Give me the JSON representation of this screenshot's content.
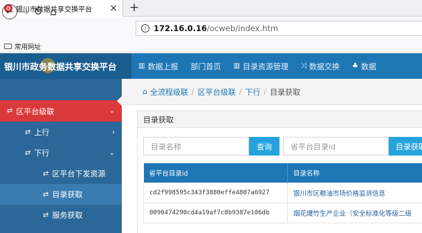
{
  "browser": {
    "tab_title": "银川市数据共享交换平台",
    "tab_close": "×",
    "new_tab": "+",
    "url_host": "172.16.0.16",
    "url_path": "/ocweb/index.htm",
    "bookmark_folder": "常用网址"
  },
  "header": {
    "brand": "银川市政务数据共享交换平台",
    "nav": [
      {
        "label": "数据上报",
        "icon": "bar-chart-icon"
      },
      {
        "label": "部门首页",
        "icon": ""
      },
      {
        "label": "目录资源管理",
        "icon": "bar-chart-icon"
      },
      {
        "label": "数据交换",
        "icon": "shuffle-icon"
      },
      {
        "label": "数据",
        "icon": "sitemap-icon"
      }
    ]
  },
  "sidebar": {
    "sync": "区平台级联",
    "up": "上行",
    "down": "下行",
    "issue": "区平台下发资源",
    "fetch": "目录获取",
    "service": "服务获取"
  },
  "breadcrumb": {
    "items": [
      "全流程级联",
      "区平台级联",
      "下行",
      "目录获取"
    ]
  },
  "panel": {
    "title": "目录获取",
    "name_placeholder": "目录名称",
    "query_label": "查询",
    "id_placeholder": "省平台目录id",
    "fetch_label": "目录获取"
  },
  "table": {
    "headers": [
      "省平台目录id",
      "目录名称"
    ],
    "rows": [
      [
        "cd2f998595c343f3880effe4807a6927",
        "银川市区粮油市场价格监测信息"
      ],
      [
        "0090474290cd4a19af7c0b9387e106db",
        "烟花爆竹生产企业（安全标准化等级二级"
      ]
    ]
  },
  "colors": {
    "header_blue": "#1f76b5",
    "sidebar_blue": "#2b6798",
    "active_red": "#d9393b",
    "button_blue": "#26a3dc"
  }
}
